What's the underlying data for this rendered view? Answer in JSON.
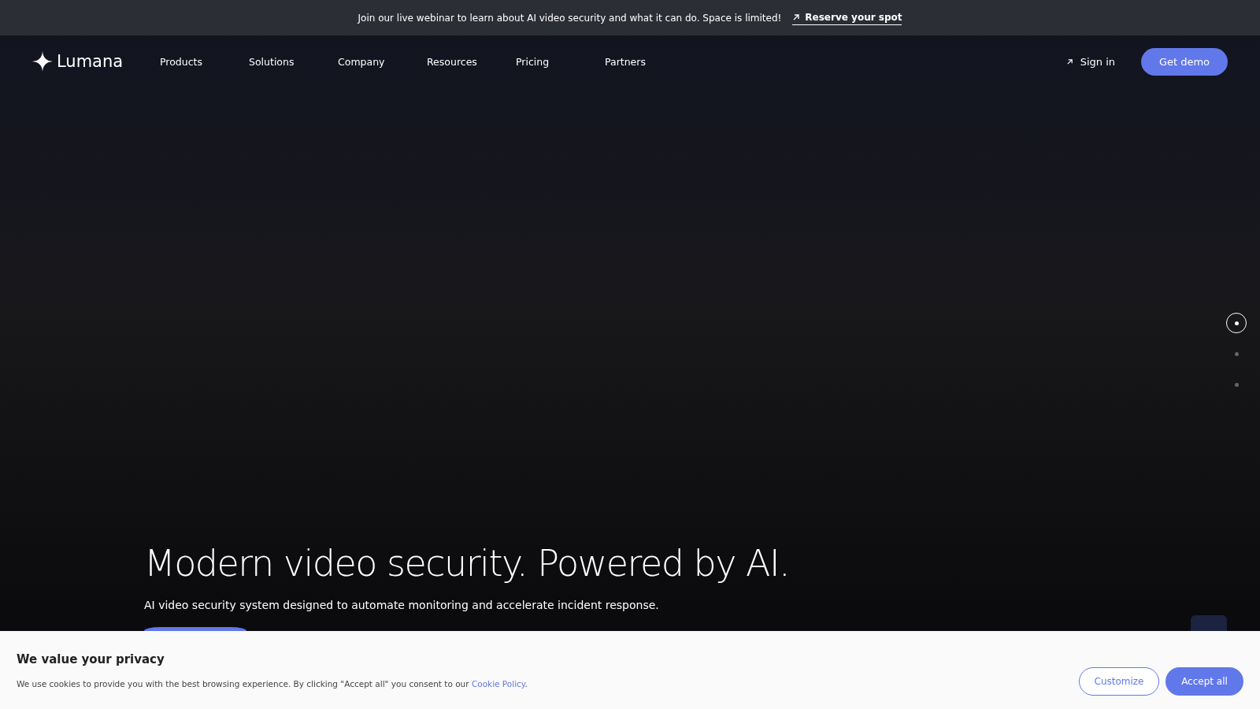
{
  "announcement": {
    "text": "Join our live webinar to learn about AI video security and what it can do. Space is limited!",
    "link": "Reserve your spot"
  },
  "nav": {
    "logo": "Lumana",
    "items": [
      "Products",
      "Solutions",
      "Company",
      "Resources",
      "Pricing",
      "Partners"
    ],
    "sign_in": "Sign in",
    "cta": "Get demo"
  },
  "hero": {
    "heading": "Modern video security. Powered by AI.",
    "subheading": "AI video security system designed to automate monitoring and accelerate incident response."
  },
  "slides": [
    {
      "selected": true
    },
    {
      "selected": false
    },
    {
      "selected": false
    }
  ],
  "cookie_banner": {
    "title": "We value your privacy",
    "text": "We use cookies to provide you with the best browsing experience. By clicking \"Accept all\" you consent to our ",
    "link": "Cookie Policy",
    "after_link": ".",
    "buttons": [
      {
        "label": "Customize",
        "kind": "outline"
      },
      {
        "label": "Accept all",
        "kind": "filled"
      }
    ]
  }
}
